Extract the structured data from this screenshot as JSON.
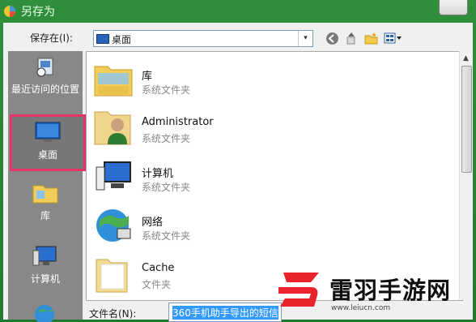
{
  "window": {
    "title": "另存为"
  },
  "toolbar": {
    "save_in_label": "保存在(I):",
    "location": "桌面",
    "dropdown_glyph": "▾"
  },
  "places": [
    {
      "label": "最近访问的位置",
      "icon": "recent-places-icon"
    },
    {
      "label": "桌面",
      "icon": "desktop-icon",
      "selected": true
    },
    {
      "label": "库",
      "icon": "libraries-icon"
    },
    {
      "label": "计算机",
      "icon": "computer-icon"
    }
  ],
  "files": [
    {
      "name": "库",
      "type": "系统文件夹",
      "icon": "libraries-folder-icon"
    },
    {
      "name": "Administrator",
      "type": "系统文件夹",
      "icon": "user-folder-icon"
    },
    {
      "name": "计算机",
      "type": "系统文件夹",
      "icon": "computer-icon"
    },
    {
      "name": "网络",
      "type": "系统文件夹",
      "icon": "network-globe-icon"
    },
    {
      "name": "Cache",
      "type": "文件夹",
      "icon": "folder-icon"
    }
  ],
  "filename": {
    "label": "文件名(N):",
    "value": "360手机助手导出的短信"
  },
  "watermark": {
    "text": "雷羽手游网",
    "url": "www.leiucn.com"
  },
  "colors": {
    "title_green": "#2f8f3b",
    "highlight": "#e8336a",
    "selection_blue": "#3399ff"
  }
}
